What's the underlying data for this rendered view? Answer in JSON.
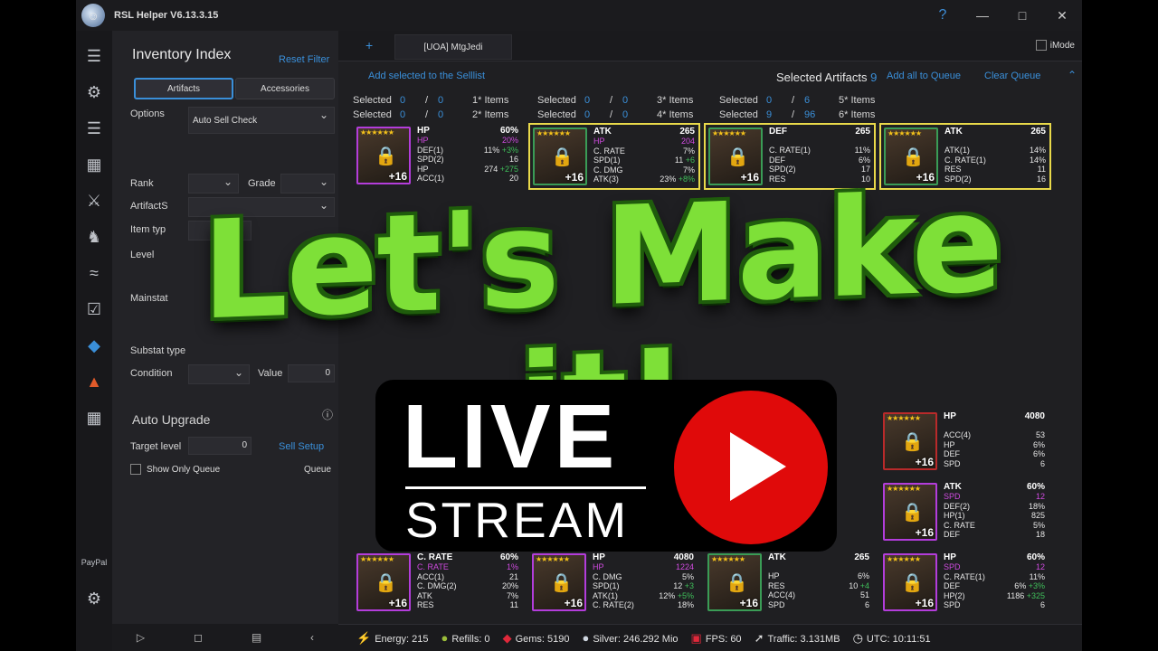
{
  "window": {
    "title": "RSL Helper V6.13.3.15",
    "help": "?",
    "min": "—",
    "max": "□",
    "close": "✕"
  },
  "rail": [
    "menu-icon",
    "gauge-icon",
    "list-icon",
    "grid-icon",
    "swords-icon",
    "dragon-icon",
    "flow-icon",
    "checklist-icon",
    "crystal-icon",
    "demon-icon",
    "building-icon",
    "paypal-icon",
    "settings-icon"
  ],
  "panel": {
    "title": "Inventory Index",
    "reset": "Reset Filter",
    "tab_artifacts": "Artifacts",
    "tab_accessories": "Accessories",
    "options_label": "Options",
    "options_value": "Auto Sell Check",
    "rank": "Rank",
    "grade": "Grade",
    "artifact_set": "ArtifactS",
    "item_type": "Item typ",
    "level": "Level",
    "mainstat": "Mainstat",
    "substat_type": "Substat type",
    "condition": "Condition",
    "value_label": "Value",
    "value": "0",
    "auto_upgrade": "Auto Upgrade",
    "info": "ⓘ",
    "target_level": "Target level",
    "target_value": "0",
    "sell_setup": "Sell Setup",
    "show_only_queue": "Show Only Queue",
    "queue": "Queue"
  },
  "main": {
    "plus": "+",
    "account": "[UOA] MtgJedi",
    "imode": "iMode",
    "add_selllist": "Add selected to the Selllist",
    "selected_artifacts_label": "Selected Artifacts",
    "selected_artifacts_count": "9",
    "add_queue": "Add all to Queue",
    "clear_queue": "Clear Queue",
    "stats": [
      {
        "label": "Selected",
        "a": "0",
        "b": "0",
        "items": "1* Items"
      },
      {
        "label": "Selected",
        "a": "0",
        "b": "0",
        "items": "2* Items"
      },
      {
        "label": "Selected",
        "a": "0",
        "b": "0",
        "items": "3* Items"
      },
      {
        "label": "Selected",
        "a": "0",
        "b": "0",
        "items": "4* Items"
      },
      {
        "label": "Selected",
        "a": "0",
        "b": "6",
        "items": "5* Items"
      },
      {
        "label": "Selected",
        "a": "9",
        "b": "96",
        "items": "6* Items"
      }
    ],
    "slash": "/"
  },
  "cards": [
    {
      "stat": "HP",
      "val": "60%",
      "sub": "HP",
      "subv": "20%",
      "lines": [
        [
          "DEF(1)",
          "11%",
          "+3%"
        ],
        [
          "SPD(2)",
          "16",
          ""
        ],
        [
          "HP",
          "274",
          "+275"
        ],
        [
          "ACC(1)",
          "20",
          ""
        ]
      ],
      "lvl": "+16",
      "frame": "pur",
      "sel": false
    },
    {
      "stat": "ATK",
      "val": "265",
      "sub": "HP",
      "subv": "204",
      "lines": [
        [
          "C. RATE",
          "7%",
          ""
        ],
        [
          "SPD(1)",
          "11",
          "+6"
        ],
        [
          "C. DMG",
          "7%",
          ""
        ],
        [
          "ATK(3)",
          "23%",
          "+8%"
        ]
      ],
      "lvl": "+16",
      "frame": "grn",
      "sel": true
    },
    {
      "stat": "DEF",
      "val": "265",
      "sub": "",
      "subv": "",
      "lines": [
        [
          "C. RATE(1)",
          "11%",
          ""
        ],
        [
          "DEF",
          "6%",
          ""
        ],
        [
          "SPD(2)",
          "17",
          ""
        ],
        [
          "RES",
          "10",
          ""
        ]
      ],
      "lvl": "+16",
      "frame": "grn",
      "sel": true
    },
    {
      "stat": "ATK",
      "val": "265",
      "sub": "",
      "subv": "",
      "lines": [
        [
          "ATK(1)",
          "14%",
          ""
        ],
        [
          "C. RATE(1)",
          "14%",
          ""
        ],
        [
          "RES",
          "11",
          ""
        ],
        [
          "SPD(2)",
          "16",
          ""
        ]
      ],
      "lvl": "+16",
      "frame": "grn",
      "sel": true
    },
    {
      "stat": "C. RATE",
      "val": "60%",
      "sub": "C. RATE",
      "subv": "1%",
      "lines": [
        [
          "ACC(1)",
          "21",
          ""
        ],
        [
          "C. DMG(2)",
          "20%",
          ""
        ],
        [
          "ATK",
          "7%",
          ""
        ],
        [
          "RES",
          "11",
          ""
        ]
      ],
      "lvl": "+16",
      "frame": "pur",
      "sel": false
    },
    {
      "stat": "HP",
      "val": "4080",
      "sub": "HP",
      "subv": "1224",
      "lines": [
        [
          "C. DMG",
          "5%",
          ""
        ],
        [
          "SPD(1)",
          "12",
          "+3"
        ],
        [
          "ATK(1)",
          "12%",
          "+5%"
        ],
        [
          "C. RATE(2)",
          "18%",
          ""
        ]
      ],
      "lvl": "+16",
      "frame": "pur",
      "sel": false
    },
    {
      "stat": "ATK",
      "val": "265",
      "sub": "",
      "subv": "",
      "lines": [
        [
          "HP",
          "6%",
          ""
        ],
        [
          "RES",
          "10",
          "+4"
        ],
        [
          "ACC(4)",
          "51",
          ""
        ],
        [
          "SPD",
          "6",
          ""
        ]
      ],
      "lvl": "+16",
      "frame": "grn",
      "sel": false
    },
    {
      "stat": "HP",
      "val": "60%",
      "sub": "SPD",
      "subv": "12",
      "lines": [
        [
          "C. RATE(1)",
          "11%",
          ""
        ],
        [
          "DEF",
          "6%",
          "+3%"
        ],
        [
          "HP(2)",
          "1186",
          "+325"
        ],
        [
          "SPD",
          "6",
          ""
        ]
      ],
      "lvl": "+16",
      "frame": "pur",
      "sel": false
    },
    {
      "stat": "HP",
      "val": "4080",
      "sub": "",
      "subv": "",
      "lines": [
        [
          "ACC(4)",
          "53",
          ""
        ],
        [
          "HP",
          "6%",
          ""
        ],
        [
          "DEF",
          "6%",
          ""
        ],
        [
          "SPD",
          "6",
          ""
        ]
      ],
      "lvl": "+16",
      "frame": "red",
      "sel": false
    },
    {
      "stat": "ATK",
      "val": "60%",
      "sub": "SPD",
      "subv": "12",
      "lines": [
        [
          "DEF(2)",
          "18%",
          ""
        ],
        [
          "HP(1)",
          "825",
          ""
        ],
        [
          "C. RATE",
          "5%",
          ""
        ],
        [
          "DEF",
          "18",
          ""
        ]
      ],
      "lvl": "+16",
      "frame": "pur",
      "sel": false
    }
  ],
  "status": {
    "energy": "Energy: 215",
    "refills": "Refills: 0",
    "gems": "Gems: 5190",
    "silver": "Silver: 246.292 Mio",
    "fps": "FPS: 60",
    "traffic": "Traffic: 3.131MB",
    "utc": "UTC: 10:11:51"
  },
  "overlay": {
    "title": "Let's Make it!",
    "live": "LIVE",
    "stream": "STREAM"
  }
}
